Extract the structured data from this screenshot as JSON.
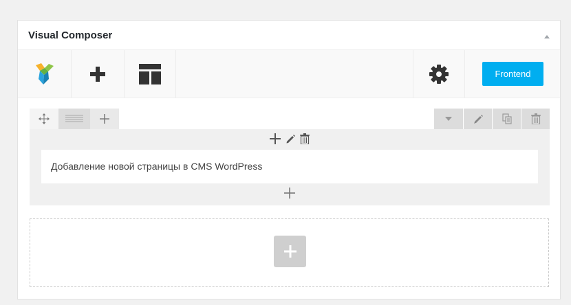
{
  "panel": {
    "title": "Visual Composer"
  },
  "toolbar": {
    "logo_icon": "vc-logo-icon",
    "add_icon": "plus-icon",
    "templates_icon": "layout-template-icon",
    "settings_icon": "gear-icon",
    "frontend_label": "Frontend"
  },
  "row": {
    "element_text": "Добавление новой страницы в CMS WordPress"
  },
  "colors": {
    "frontend_button": "#00aef0",
    "logo_yellow": "#f6b22c",
    "logo_green": "#8ec548",
    "logo_blue": "#2aa3dd",
    "logo_teal": "#1a82b4"
  }
}
